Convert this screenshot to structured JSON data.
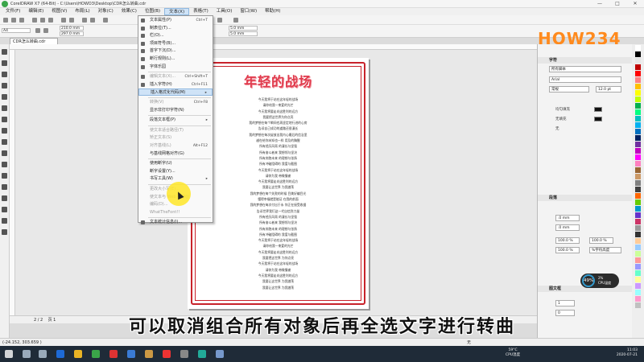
{
  "window": {
    "title": "CorelDRAW X7 (64-Bit) - C:\\Users\\HOWO3\\Desktop\\CDR怎么转曲.cdr",
    "controls": [
      "—",
      "□",
      "✕"
    ]
  },
  "menubar": [
    "文件(F)",
    "编辑(E)",
    "视图(V)",
    "布局(L)",
    "对象(C)",
    "效果(C)",
    "位图(B)",
    "文本(X)",
    "表格(T)",
    "工具(O)",
    "窗口(W)",
    "帮助(H)"
  ],
  "menubar_active": "文本(X)",
  "toolbar": {
    "preset": "A4",
    "width": "210.0 mm",
    "height": "297.0 mm",
    "nudge1": "5.0 mm",
    "nudge2": "5.0 mm"
  },
  "doc_tab": "CDR怎么转曲.cdr",
  "text_menu": {
    "items": [
      {
        "label": "文本属性(P)",
        "shortcut": "Ctrl+T",
        "disabled": false,
        "icon": "text-props-icon"
      },
      {
        "label": "制表位(T)...",
        "shortcut": "",
        "disabled": false,
        "icon": "tab-icon"
      },
      {
        "label": "栏(O)...",
        "shortcut": "",
        "disabled": false,
        "icon": "columns-icon"
      },
      {
        "label": "项目符号(B)...",
        "shortcut": "",
        "disabled": false,
        "icon": "bullet-icon"
      },
      {
        "label": "首字下沉(D)...",
        "shortcut": "",
        "disabled": false,
        "icon": "dropcap-icon"
      },
      {
        "label": "断行规则(L)...",
        "shortcut": "",
        "disabled": false,
        "icon": "linebreak-icon"
      },
      {
        "label": "字体乐园",
        "shortcut": "",
        "disabled": false,
        "icon": "font-playground-icon"
      },
      {
        "label": "编辑文本(X)...",
        "shortcut": "Ctrl+Shift+T",
        "disabled": true,
        "icon": "edit-text-icon"
      },
      {
        "label": "插入字符(H)",
        "shortcut": "Ctrl+F11",
        "disabled": false,
        "icon": "insert-char-icon"
      },
      {
        "label": "插入格式化代码(M)",
        "shortcut": "",
        "disabled": false,
        "icon": "",
        "highlight": true,
        "submenu": true
      },
      {
        "label": "转换(V)",
        "shortcut": "Ctrl+F8",
        "disabled": true,
        "icon": ""
      },
      {
        "label": "显示非打印字符(N)",
        "shortcut": "",
        "disabled": false,
        "icon": ""
      },
      {
        "label": "段落文本框(P)",
        "shortcut": "",
        "disabled": false,
        "icon": "",
        "submenu": true
      },
      {
        "label": "使文本适合路径(T)",
        "shortcut": "",
        "disabled": true,
        "icon": ""
      },
      {
        "label": "矫正文本(S)",
        "shortcut": "",
        "disabled": true,
        "icon": ""
      },
      {
        "label": "对齐基线(L)",
        "shortcut": "Alt+F12",
        "disabled": true,
        "icon": ""
      },
      {
        "label": "与基线网格对齐(G)",
        "shortcut": "",
        "disabled": false,
        "icon": ""
      },
      {
        "label": "使用断字(U)",
        "shortcut": "",
        "disabled": false,
        "icon": ""
      },
      {
        "label": "断字设置(Y)...",
        "shortcut": "",
        "disabled": false,
        "icon": ""
      },
      {
        "label": "书写工具(W)",
        "shortcut": "",
        "disabled": false,
        "icon": "",
        "submenu": true
      },
      {
        "label": "更改大小写(E)...",
        "shortcut": "",
        "disabled": true,
        "icon": ""
      },
      {
        "label": "使文本与 Web 兼容(J)",
        "shortcut": "",
        "disabled": true,
        "icon": ""
      },
      {
        "label": "编码(D)...",
        "shortcut": "",
        "disabled": true,
        "icon": ""
      },
      {
        "label": "WhatTheFont!!",
        "shortcut": "",
        "disabled": true,
        "icon": ""
      },
      {
        "label": "文本统计信息(I)...",
        "shortcut": "",
        "disabled": false,
        "icon": "stats-icon"
      }
    ]
  },
  "page": {
    "title": "年轻的战场",
    "lines": [
      "今天我将于站在这年轻的战场",
      "请你给我一束爱的光芒",
      "今天我将要走向这胜利的远方",
      "我要把这世界为你点亮",
      "我的梦想在每个瞬间也再坚定地行进的心房",
      "告诉自己成功的道路还很漫长",
      "我的梦想在每次绽放出我内心最后的信念里",
      "越在给你未知也一样 用及的胸膛",
      "所有经历风雨 的漫长与坚强",
      "所有奋斗者来 我想领与坚决",
      "所有奔跑未来 的理想与张扬",
      "所有冲破阻碍的 我爱与截图",
      "今天我将于站在这年轻的战场",
      "请你为我 带微慢谢",
      "今天我将要走向这胜利的远方",
      "我要让这世界 为我激荡",
      "我的梦想在每个失败的时候 目美好编目光",
      "懂得幸福就是能证 在我的前面",
      "我的梦想在每次付出于永 你正在接受收据",
      "告诉世界我们这一代自信到力量",
      "所有经历风雨 的漫长与坚强",
      "所有奋斗者来 我想领与坚决",
      "所有奔跑未来 的理想与张扬",
      "所有冲破阻碍的 我爱与截图",
      "今天我将于站在这年轻的战场",
      "请你给我一束爱的光芒",
      "今天我将要走向这胜利的远方",
      "我要把这世界 为你点亮",
      "今天我将于站在这年轻的战场",
      "请你为我 带微慢谢",
      "今天我将要走向这胜利的远方",
      "我要让这世界 为我激荡",
      "我要让这世界 为我激荡"
    ]
  },
  "right_logo": "HOW234",
  "panel": {
    "char_header": "字符",
    "font_list": "所有脚本",
    "font_name": "Arial",
    "font_style": "常规",
    "font_size": "12.0 pt",
    "fill_label": "均匀填充",
    "outline_fill_label": "无填充",
    "bg_label": "无",
    "para_header": "段落",
    "spacing1": ".0 mm",
    "spacing2": ".0 mm",
    "spacing3": "100.0 %",
    "spacing4": "100.0 %",
    "spacing5": "100.0 %",
    "char_height_label": "%字符高度",
    "frame_header": "图文框",
    "frame_value": "1",
    "frame_value2": "0"
  },
  "cpu_badge": {
    "percent": "49%",
    "label": "CPU温度",
    "sub": "2%"
  },
  "pagebar": {
    "page_info": "2 / 2",
    "page_name": "页 1"
  },
  "statusbar": {
    "coords": "(-24.152, 303.659 )",
    "fill_status": "无"
  },
  "caption": "可以取消组合所有对象后再全选文字进行转曲",
  "taskbar": {
    "temp": "59°C",
    "temp_label": "CPU温度",
    "time": "11:03",
    "date": "2020-07-21"
  },
  "colors": {
    "accent_red": "#c8232b",
    "title_red": "#e03a4c",
    "menu_highlight": "#cfe3f7",
    "logo_orange": "#ff8a1d"
  }
}
